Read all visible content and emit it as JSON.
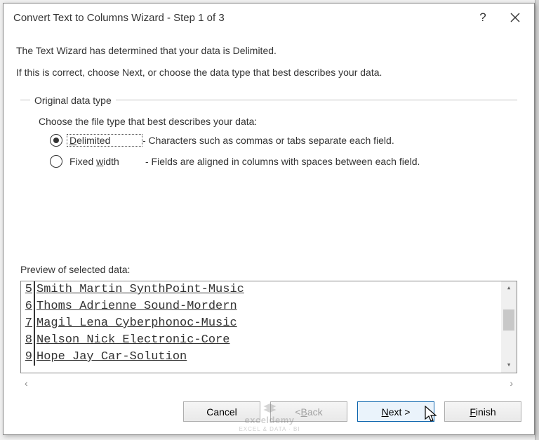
{
  "title": "Convert Text to Columns Wizard - Step 1 of 3",
  "intro": {
    "line1": "The Text Wizard has determined that your data is Delimited.",
    "line2": "If this is correct, choose Next, or choose the data type that best describes your data."
  },
  "group": {
    "legend": "Original data type",
    "prompt": "Choose the file type that best describes your data:",
    "options": [
      {
        "label_pre": "",
        "accel": "D",
        "label_post": "elimited",
        "desc": "- Characters such as commas or tabs separate each field.",
        "selected": true
      },
      {
        "label_pre": "Fixed ",
        "accel": "w",
        "label_post": "idth",
        "desc": "- Fields are aligned in columns with spaces between each field.",
        "selected": false
      }
    ]
  },
  "preview": {
    "label": "Preview of selected data:",
    "rows": [
      {
        "n": "5",
        "text": "Smith Martin SynthPoint-Music"
      },
      {
        "n": "6",
        "text": "Thoms Adrienne Sound-Mordern"
      },
      {
        "n": "7",
        "text": "Magil Lena Cyberphonoc-Music"
      },
      {
        "n": "8",
        "text": "Nelson Nick Electronic-Core"
      },
      {
        "n": "9",
        "text": "Hope Jay Car-Solution"
      }
    ]
  },
  "buttons": {
    "cancel": "Cancel",
    "back_pre": "< ",
    "back_accel": "B",
    "back_post": "ack",
    "next_accel": "N",
    "next_post": "ext >",
    "finish_accel": "F",
    "finish_post": "inish"
  },
  "watermark": {
    "line1": "exceldemy",
    "line2": "EXCEL & DATA · BI"
  }
}
